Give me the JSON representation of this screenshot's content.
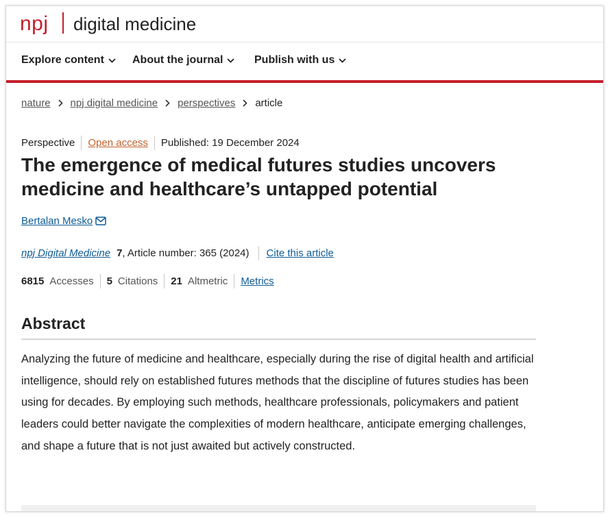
{
  "header": {
    "brand_short": "npj",
    "brand_name": "digital medicine"
  },
  "nav": {
    "items": [
      {
        "label": "Explore content"
      },
      {
        "label": "About the journal"
      },
      {
        "label": "Publish with us"
      }
    ]
  },
  "breadcrumb": {
    "items": [
      "nature",
      "npj digital medicine",
      "perspectives"
    ],
    "current": "article"
  },
  "article": {
    "type": "Perspective",
    "access": "Open access",
    "published": "Published: 19 December 2024",
    "title": "The emergence of medical futures studies uncovers medicine and healthcare’s untapped potential",
    "author": "Bertalan Mesko",
    "journal": "npj Digital Medicine",
    "volume": "7",
    "article_number": ", Article number: 365 (2024)",
    "cite_label": "Cite this article",
    "metrics": {
      "accesses_value": "6815",
      "accesses_label": "Accesses",
      "citations_value": "5",
      "citations_label": "Citations",
      "altmetric_value": "21",
      "altmetric_label": "Altmetric",
      "metrics_link": "Metrics"
    },
    "abstract_heading": "Abstract",
    "abstract_text": "Analyzing the future of medicine and healthcare, especially during the rise of digital health and artificial intelligence, should rely on established futures methods that the discipline of futures studies has been using for decades. By employing such methods, healthcare professionals, policymakers and patient leaders could better navigate the complexities of modern healthcare, anticipate emerging challenges, and shape a future that is not just awaited but actively constructed."
  },
  "colors": {
    "brand_red": "#c41e2a",
    "link_blue": "#0f5b96",
    "open_access_orange": "#c4612c"
  },
  "icons": {
    "nav_dropdown": "chevron-down-icon",
    "breadcrumb_separator": "chevron-right-icon",
    "author_contact": "envelope-icon"
  }
}
